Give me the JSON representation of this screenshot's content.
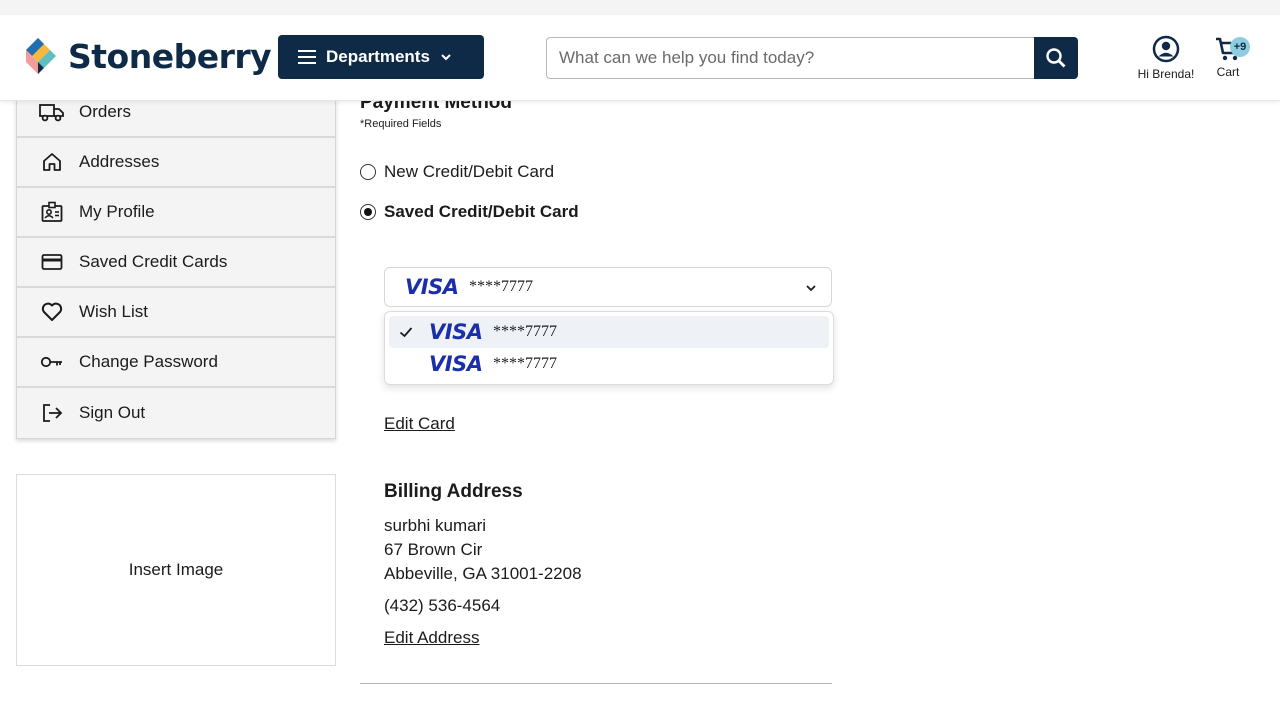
{
  "header": {
    "logo_text": "Stoneberry",
    "departments_label": "Departments",
    "search_placeholder": "What can we help you find today?",
    "account_label": "Hi Brenda!",
    "cart_label": "Cart",
    "cart_badge": "+9",
    "brand_color": "#0e2a47"
  },
  "sidebar": {
    "items": [
      {
        "label": "Orders",
        "icon": "truck-icon"
      },
      {
        "label": "Addresses",
        "icon": "home-icon"
      },
      {
        "label": "My Profile",
        "icon": "id-badge-icon"
      },
      {
        "label": "Saved Credit Cards",
        "icon": "credit-card-icon"
      },
      {
        "label": "Wish List",
        "icon": "heart-icon"
      },
      {
        "label": "Change Password",
        "icon": "key-icon"
      },
      {
        "label": "Sign Out",
        "icon": "sign-out-icon"
      }
    ]
  },
  "image_placeholder": "Insert Image",
  "payment": {
    "title": "Payment Method",
    "required_note": "*Required Fields",
    "option_new": "New Credit/Debit Card",
    "option_saved": "Saved Credit/Debit Card",
    "selected_option": "saved",
    "selected_card": {
      "brand": "VISA",
      "masked": "****7777"
    },
    "dropdown_options": [
      {
        "brand": "VISA",
        "masked": "****7777",
        "selected": true
      },
      {
        "brand": "VISA",
        "masked": "****7777",
        "selected": false
      }
    ],
    "edit_card": "Edit Card"
  },
  "billing": {
    "title": "Billing Address",
    "name": "surbhi kumari",
    "street": "67 Brown Cir",
    "city_state_zip": "Abbeville, GA 31001-2208",
    "phone": "(432) 536-4564",
    "edit_address": "Edit Address"
  }
}
